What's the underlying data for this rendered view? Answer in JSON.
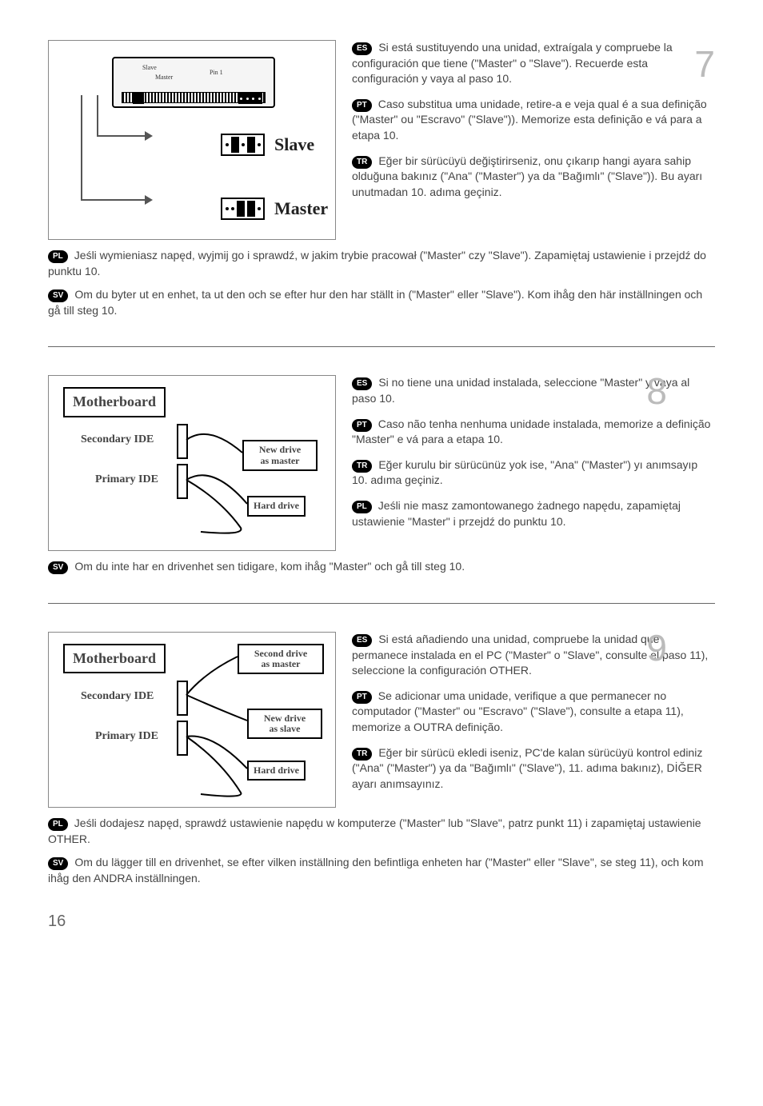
{
  "page_number": "16",
  "steps": {
    "s7": {
      "number": "7",
      "fig": {
        "top_slave": "Slave",
        "top_master": "Master",
        "top_pin1": "Pin 1",
        "slave_label": "Slave",
        "master_label": "Master"
      },
      "es": "Si está sustituyendo una unidad, extraígala y compruebe la configuración que tiene (\"Master\" o \"Slave\"). Recuerde esta configuración y vaya al paso 10.",
      "pt": "Caso substitua uma unidade, retire-a e veja qual é a sua definição (\"Master\" ou \"Escravo\" (\"Slave\")). Memorize esta definição e vá para a etapa 10.",
      "tr": "Eğer bir sürücüyü değiştirirseniz, onu çıkarıp hangi ayara sahip olduğuna bakınız (\"Ana\" (\"Master\") ya da \"Bağımlı\" (\"Slave\")). Bu ayarı unutmadan 10. adıma geçiniz.",
      "pl": "Jeśli wymieniasz napęd, wyjmij go i sprawdź, w jakim trybie pracował (\"Master\" czy \"Slave\"). Zapamiętaj ustawienie i przejdź do punktu 10.",
      "sv": "Om du byter ut en enhet, ta ut den och se efter hur den har ställt in (\"Master\" eller \"Slave\"). Kom ihåg den här inställningen och gå till steg 10."
    },
    "s8": {
      "number": "8",
      "fig": {
        "motherboard": "Motherboard",
        "secondary": "Secondary IDE",
        "primary": "Primary IDE",
        "newdrive": "New drive\nas master",
        "harddrive": "Hard drive"
      },
      "es": "Si no tiene una unidad instalada, seleccione \"Master\" y vaya al paso 10.",
      "pt": "Caso não tenha nenhuma unidade instalada, memorize a definição \"Master\" e vá para a etapa 10.",
      "tr": "Eğer kurulu bir sürücünüz yok ise, \"Ana\" (\"Master\") yı anımsayıp 10. adıma geçiniz.",
      "pl": "Jeśli nie masz zamontowanego żadnego napędu, zapamiętaj ustawienie \"Master\" i przejdź do punktu 10.",
      "sv": "Om du inte har en drivenhet sen tidigare, kom ihåg \"Master\" och gå till steg 10."
    },
    "s9": {
      "number": "9",
      "fig": {
        "motherboard": "Motherboard",
        "secondary": "Secondary IDE",
        "primary": "Primary IDE",
        "seconddrive": "Second drive\nas master",
        "newdrive": "New drive\nas slave",
        "harddrive": "Hard drive"
      },
      "es": "Si está añadiendo una unidad, compruebe la unidad que permanece instalada en el PC (\"Master\" o \"Slave\", consulte el paso 11), seleccione la configuración OTHER.",
      "pt": "Se adicionar uma unidade, verifique a que permanecer no computador (\"Master\" ou \"Escravo\" (\"Slave\"), consulte a etapa 11), memorize a OUTRA definição.",
      "tr": "Eğer bir sürücü ekledi iseniz, PC'de kalan sürücüyü kontrol ediniz (\"Ana\" (\"Master\") ya da \"Bağımlı\" (\"Slave\"), 11. adıma bakınız), DİĞER ayarı anımsayınız.",
      "pl": "Jeśli dodajesz napęd, sprawdź ustawienie napędu w komputerze (\"Master\" lub \"Slave\", patrz punkt 11) i zapamiętaj ustawienie OTHER.",
      "sv": "Om du lägger till en drivenhet, se efter vilken inställning den befintliga enheten har (\"Master\" eller \"Slave\", se steg 11), och kom ihåg den ANDRA inställningen."
    }
  },
  "badges": {
    "es": "ES",
    "pt": "PT",
    "tr": "TR",
    "pl": "PL",
    "sv": "SV"
  }
}
